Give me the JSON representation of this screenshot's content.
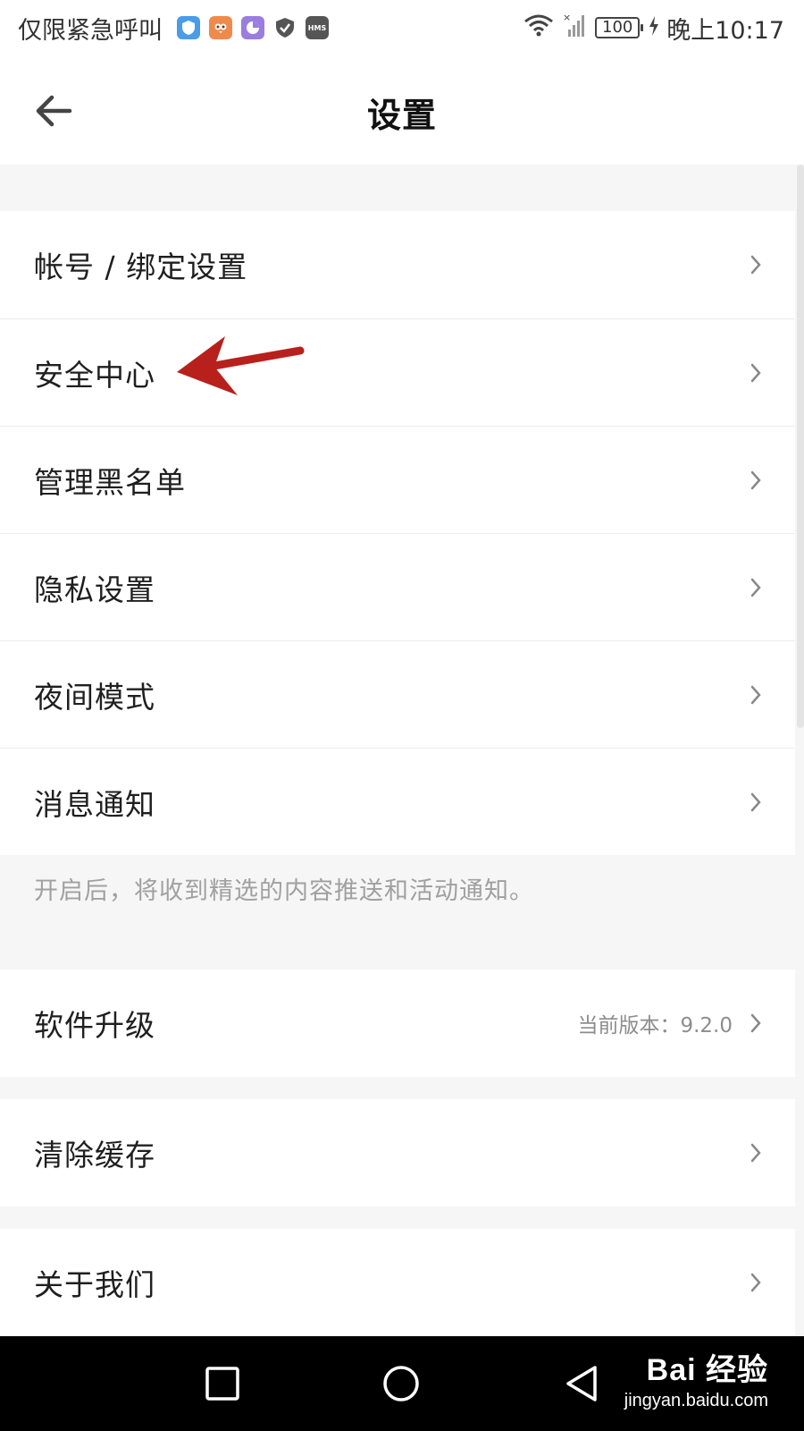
{
  "status_bar": {
    "carrier": "仅限紧急呼叫",
    "battery": "100",
    "time": "晚上10:17",
    "app_icons": [
      "shield-app-icon",
      "owl-app-icon",
      "chart-app-icon",
      "security-shield-icon",
      "hms-icon"
    ],
    "hms_label": "HMS"
  },
  "header": {
    "title": "设置"
  },
  "settings": {
    "group1": [
      {
        "label": "帐号 / 绑定设置"
      },
      {
        "label": "安全中心"
      },
      {
        "label": "管理黑名单"
      },
      {
        "label": "隐私设置"
      },
      {
        "label": "夜间模式"
      },
      {
        "label": "消息通知"
      }
    ],
    "notice": "开启后，将收到精选的内容推送和活动通知。",
    "upgrade": {
      "label": "软件升级",
      "value": "当前版本：9.2.0"
    },
    "clear_cache": {
      "label": "清除缓存"
    },
    "about": {
      "label": "关于我们"
    }
  },
  "watermark": {
    "main": "Bai 经验",
    "sub": "jingyan.baidu.com"
  },
  "colors": {
    "background": "#f6f6f6",
    "row_bg": "#ffffff",
    "annotation_arrow": "#b8201c",
    "nav_bar": "#000000"
  }
}
